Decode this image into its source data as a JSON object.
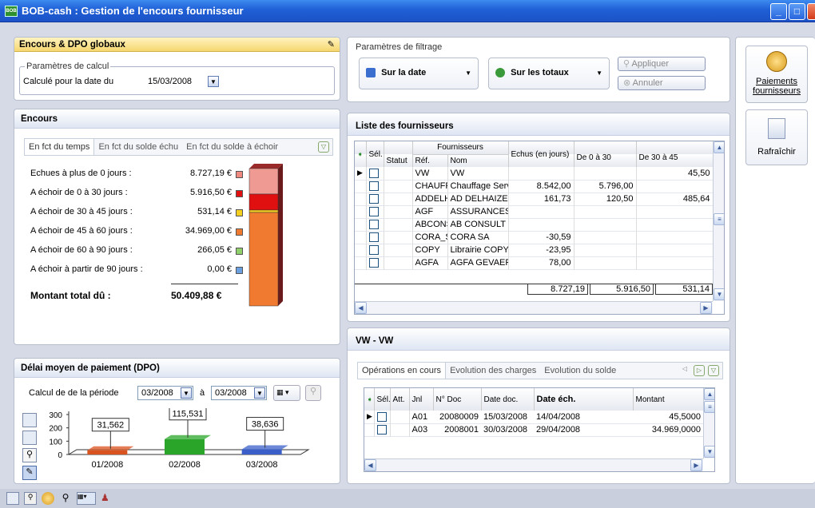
{
  "window": {
    "title": "BOB-cash : Gestion de l'encours fournisseur",
    "app_icon": "BOB"
  },
  "encours_dpo": {
    "title": "Encours & DPO globaux",
    "pin_icon": "pin-icon",
    "params_label": "Paramètres de calcul",
    "date_label": "Calculé pour la date du",
    "date_value": "15/03/2008"
  },
  "filtrage": {
    "label": "Paramètres de filtrage",
    "sur_date": "Sur la date",
    "sur_totaux": "Sur les totaux",
    "appliquer": "Appliquer",
    "annuler": "Annuler"
  },
  "side": {
    "paiements": "Paiements fournisseurs",
    "rafraichir": "Rafraîchir"
  },
  "encours": {
    "title": "Encours",
    "tabs": [
      "En fct du temps",
      "En fct du solde échu",
      "En fct du solde à échoir"
    ],
    "rows": [
      {
        "label": "Echues à plus de 0 jours :",
        "value": "8.727,19 €",
        "color": "#f08a80"
      },
      {
        "label": "A échoir de 0 à 30 jours :",
        "value": "5.916,50 €",
        "color": "#e01010"
      },
      {
        "label": "A échoir de 30 à 45 jours :",
        "value": "531,14 €",
        "color": "#f5d020"
      },
      {
        "label": "A échoir de 45 à 60 jours :",
        "value": "34.969,00 €",
        "color": "#f07a30"
      },
      {
        "label": "A échoir de 60 à 90 jours :",
        "value": "266,05 €",
        "color": "#8fd06a"
      },
      {
        "label": "A échoir à partir de 90 jours :",
        "value": "0,00 €",
        "color": "#6aa0e0"
      }
    ],
    "total_label": "Montant total dû :",
    "total_value": "50.409,88 €"
  },
  "dpo": {
    "title": "Délai moyen de paiement (DPO)",
    "period_label": "Calcul de de la période",
    "from": "03/2008",
    "a": "à",
    "to": "03/2008",
    "chart_data": {
      "type": "bar",
      "categories": [
        "01/2008",
        "02/2008",
        "03/2008"
      ],
      "values": [
        31.562,
        115.531,
        38.636
      ],
      "labels": [
        "31,562",
        "115,531",
        "38,636"
      ],
      "ylim": [
        0,
        300
      ],
      "yticks": [
        "300",
        "200",
        "100",
        "0"
      ],
      "colors": [
        "#d9531e",
        "#2aa52a",
        "#3a5fc8"
      ]
    }
  },
  "fournisseurs": {
    "title": "Liste des fournisseurs",
    "group_header": "Fournisseurs",
    "headers": [
      "Sél.",
      "Statut",
      "Réf.",
      "Nom",
      "Echus (en jours)",
      "De 0 à 30",
      "De 30 à 45"
    ],
    "rows": [
      [
        "VW",
        "VW",
        "",
        "",
        "45,50"
      ],
      [
        "CHAUFF",
        "Chauffage Serv",
        "8.542,00",
        "5.796,00",
        ""
      ],
      [
        "ADDELHA",
        "AD DELHAIZE",
        "161,73",
        "120,50",
        "485,64"
      ],
      [
        "AGF",
        "ASSURANCES",
        "",
        "",
        ""
      ],
      [
        "ABCONSL",
        "AB CONSULT",
        "",
        "",
        ""
      ],
      [
        "CORA_SA",
        "CORA SA",
        "-30,59",
        "",
        ""
      ],
      [
        "COPY",
        "Librairie COPY",
        "-23,95",
        "",
        ""
      ],
      [
        "AGFA",
        "AGFA GEVAER",
        "78,00",
        "",
        ""
      ]
    ],
    "totals": [
      "8.727,19",
      "5.916,50",
      "531,14"
    ]
  },
  "vw": {
    "title": "VW - VW",
    "tabs": [
      "Opérations en cours",
      "Evolution des charges",
      "Evolution du solde"
    ],
    "headers": [
      "Sél.",
      "Att.",
      "Jnl",
      "N° Doc",
      "Date doc.",
      "Date éch.",
      "Montant"
    ],
    "rows": [
      [
        "A01",
        "20080009",
        "15/03/2008",
        "14/04/2008",
        "45,5000"
      ],
      [
        "A03",
        "2008001",
        "30/03/2008",
        "29/04/2008",
        "34.969,0000"
      ]
    ]
  }
}
